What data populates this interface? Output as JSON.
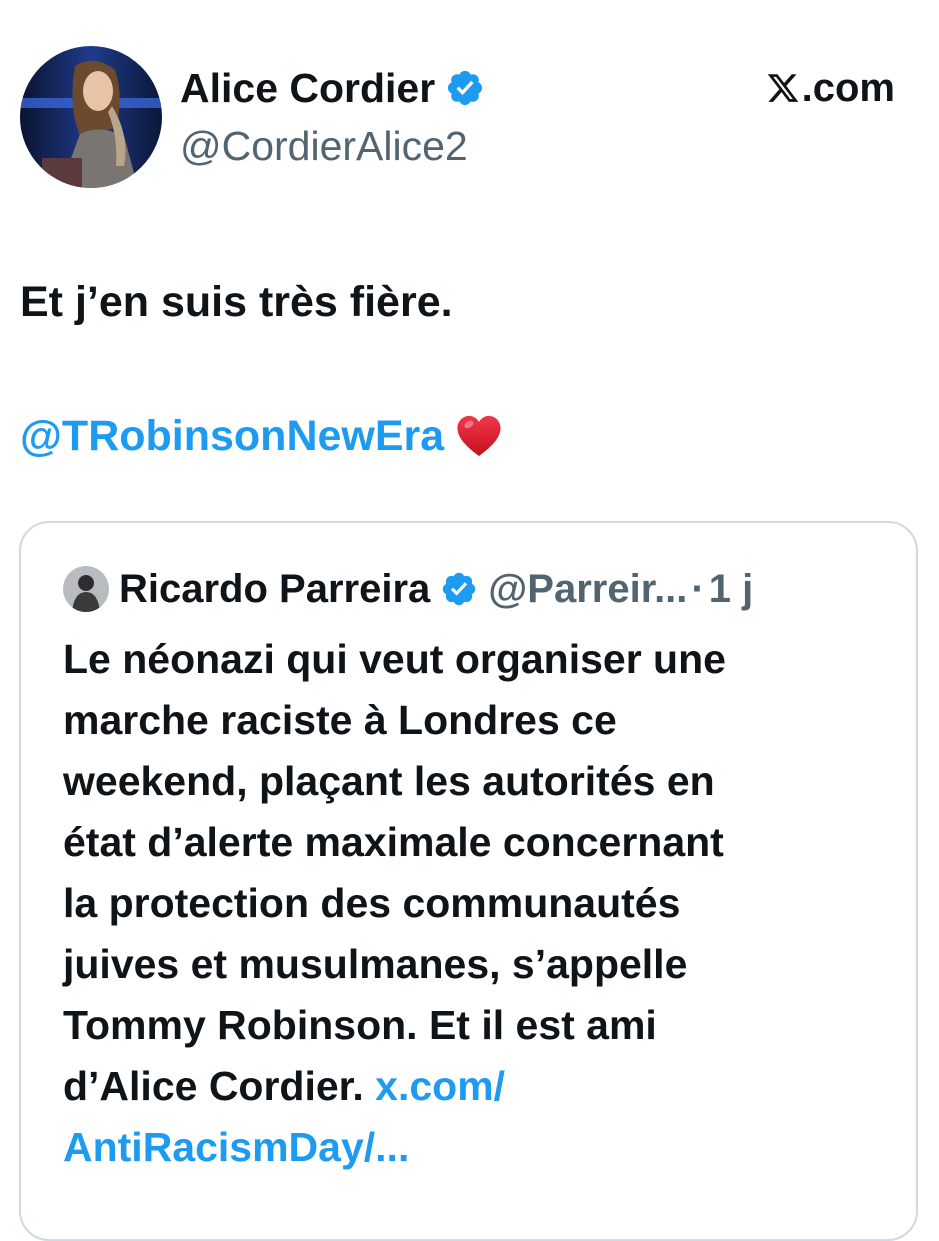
{
  "author": {
    "name": "Alice Cordier",
    "handle": "@CordierAlice2",
    "verified": true
  },
  "source_label": ".com",
  "colors": {
    "link": "#1d9bf0",
    "secondary_text": "#536471",
    "verified_badge": "#1d9bf0",
    "card_border": "#cfd9de"
  },
  "tweet": {
    "text": "Et j’en suis très fière.",
    "mention": "@TRobinsonNewEra",
    "emoji_icon": "red-heart-icon"
  },
  "quote": {
    "author_name": "Ricardo Parreira",
    "author_handle": "@Parreir...",
    "separator": "·",
    "time": "1 j",
    "lines": [
      "Le néonazi qui veut organiser une",
      "marche raciste à Londres ce",
      "weekend, plaçant les autorités en",
      "état d’alerte maximale concernant",
      "la protection des communautés",
      "juives et musulmanes, s’appelle",
      "Tommy Robinson. Et il est ami"
    ],
    "last_line_text": "d’Alice Cordier. ",
    "link_part1": "x.com/",
    "link_part2": "AntiRacismDay/..."
  }
}
